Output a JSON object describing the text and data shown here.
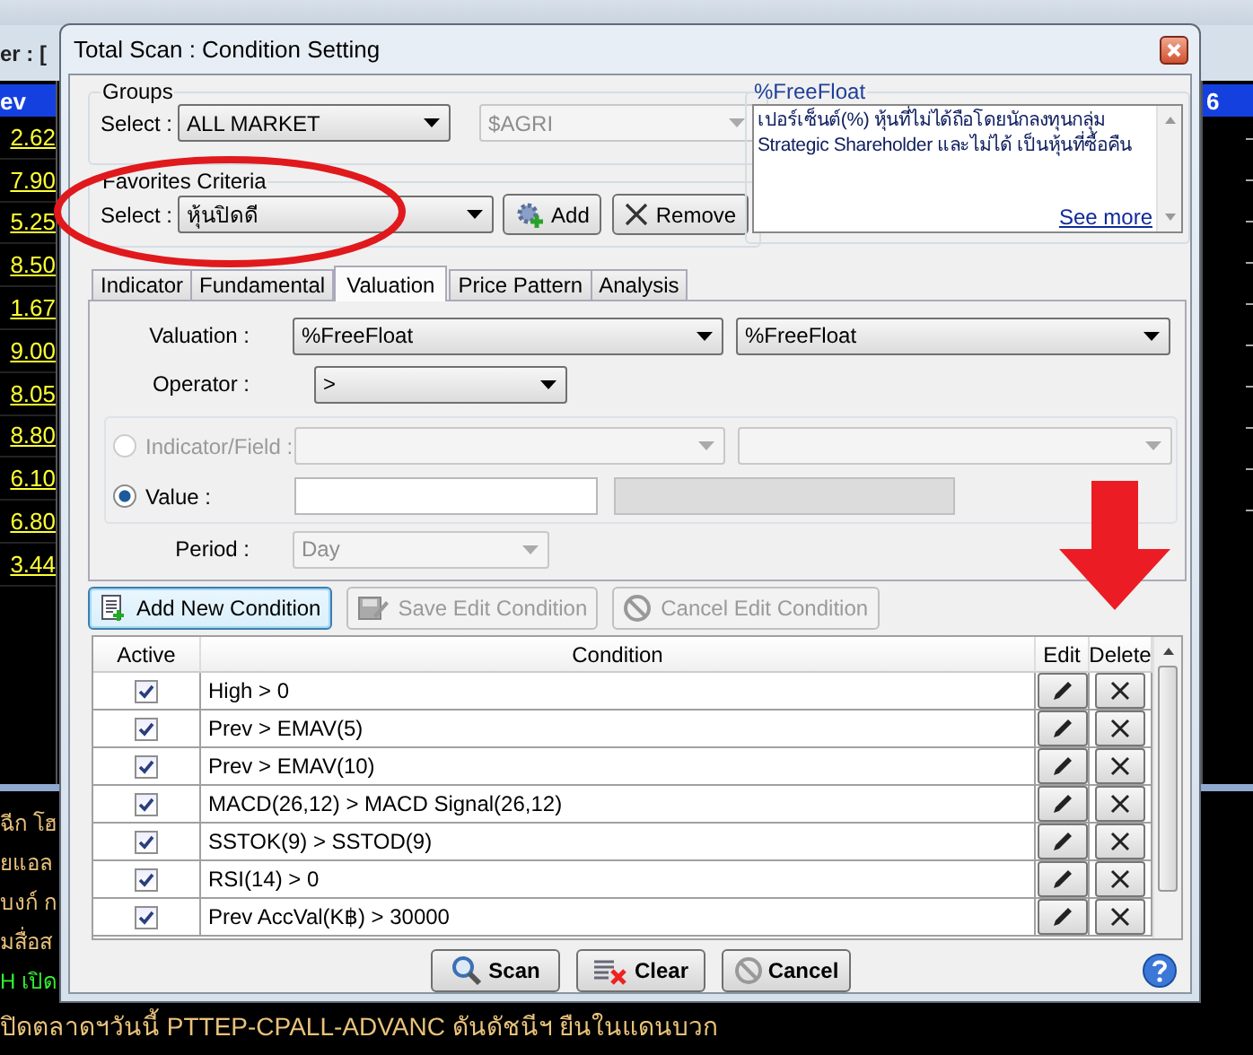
{
  "background": {
    "filter_label": "er : [",
    "column_header": "ev",
    "right_header": "6",
    "prices": [
      "2.62",
      "7.90",
      "5.25",
      "8.50",
      "1.67",
      "9.00",
      "8.05",
      "8.80",
      "6.10",
      "6.80",
      "3.44"
    ],
    "news": [
      {
        "text": "ฉีก โฮ",
        "kind": "normal"
      },
      {
        "text": "ยแอล",
        "kind": "normal"
      },
      {
        "text": "บงก์ ก",
        "kind": "normal"
      },
      {
        "text": "มสื่อส",
        "kind": "normal"
      },
      {
        "text": "H เปิด",
        "kind": "highlight"
      }
    ],
    "ticker": "ปิดตลาดฯวันนี้ PTTEP-CPALL-ADVANC ดันดัชนีฯ ยืนในแดนบวก"
  },
  "dialog": {
    "title": "Total Scan : Condition Setting",
    "groups": {
      "title": "Groups",
      "select_label": "Select :",
      "market": {
        "value": "ALL MARKET",
        "disabled": false
      },
      "sector": {
        "value": "$AGRI",
        "disabled": true
      }
    },
    "favorites": {
      "title": "Favorites Criteria",
      "select_label": "Select :",
      "criteria": "หุ้นปิดดี",
      "add": "Add",
      "remove": "Remove"
    },
    "info": {
      "title": "%FreeFloat",
      "text": "เปอร์เซ็นต์(%) หุ้นที่ไม่ได้ถือโดยนักลงทุนกลุ่ม Strategic Shareholder และไม่ได้ เป็นหุ้นที่ซื้อคืน",
      "link": "See more"
    },
    "tabs": [
      {
        "label": "Indicator",
        "selected": false
      },
      {
        "label": "Fundamental",
        "selected": false
      },
      {
        "label": "Valuation",
        "selected": true
      },
      {
        "label": "Price Pattern",
        "selected": false
      },
      {
        "label": "Analysis",
        "selected": false
      }
    ],
    "form": {
      "valuation_label": "Valuation :",
      "valuation": [
        {
          "value": "%FreeFloat",
          "disabled": false
        },
        {
          "value": "%FreeFloat",
          "disabled": false
        }
      ],
      "operator_label": "Operator :",
      "operator": ">",
      "sources": [
        {
          "kind": "field",
          "label": "Indicator/Field :",
          "selected": false
        },
        {
          "kind": "value",
          "label": "Value :",
          "selected": true
        }
      ],
      "period_label": "Period :",
      "period": {
        "value": "Day",
        "disabled": true
      }
    },
    "actions": [
      {
        "kind": "add",
        "label": "Add New Condition",
        "disabled": false
      },
      {
        "kind": "save",
        "label": "Save Edit Condition",
        "disabled": true
      },
      {
        "kind": "cancel",
        "label": "Cancel Edit Condition",
        "disabled": true
      }
    ],
    "table": {
      "columns": [
        "Active",
        "Condition",
        "Edit",
        "Delete"
      ],
      "rows": [
        {
          "active": true,
          "condition": "High > 0"
        },
        {
          "active": true,
          "condition": "Prev > EMAV(5)"
        },
        {
          "active": true,
          "condition": "Prev > EMAV(10)"
        },
        {
          "active": true,
          "condition": "MACD(26,12) > MACD Signal(26,12)"
        },
        {
          "active": true,
          "condition": "SSTOK(9) > SSTOD(9)"
        },
        {
          "active": true,
          "condition": "RSI(14) > 0"
        },
        {
          "active": true,
          "condition": "Prev AccVal(K฿) > 30000"
        }
      ]
    },
    "buttons": [
      {
        "kind": "scan",
        "label": "Scan"
      },
      {
        "kind": "clear",
        "label": "Clear"
      },
      {
        "kind": "cancel",
        "label": "Cancel"
      }
    ]
  }
}
